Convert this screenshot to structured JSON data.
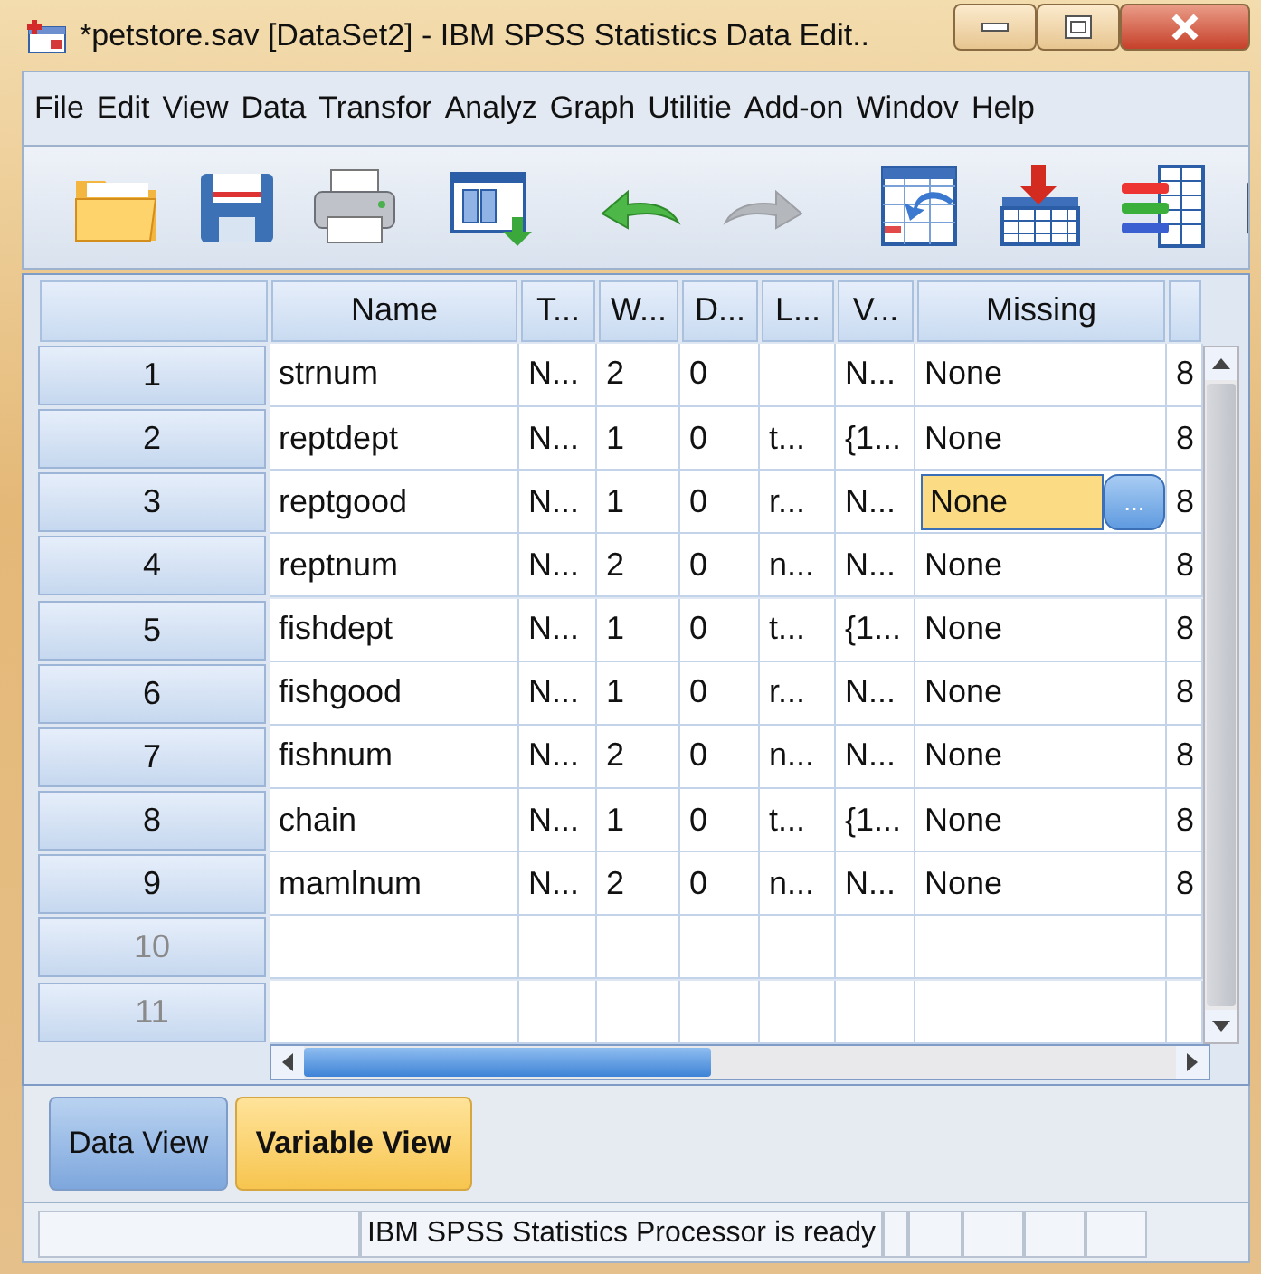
{
  "window": {
    "title": "*petstore.sav [DataSet2] - IBM SPSS Statistics Data Edit.."
  },
  "menu": [
    "File",
    "Edit",
    "View",
    "Data",
    "Transfor",
    "Analyz",
    "Graph",
    "Utilitie",
    "Add-on",
    "Windov",
    "Help"
  ],
  "toolbar": [
    {
      "kind": "open",
      "disabled": false
    },
    {
      "kind": "save",
      "disabled": false
    },
    {
      "kind": "print",
      "disabled": false
    },
    {
      "kind": "recall",
      "disabled": false
    },
    {
      "kind": "undo",
      "disabled": false
    },
    {
      "kind": "redo",
      "disabled": true
    },
    {
      "kind": "goto",
      "disabled": false
    },
    {
      "kind": "insert",
      "disabled": false
    },
    {
      "kind": "variables",
      "disabled": false
    },
    {
      "kind": "partial",
      "disabled": false
    }
  ],
  "table": {
    "columns": [
      {
        "label": "Name",
        "current": false
      },
      {
        "label": "T...",
        "current": false
      },
      {
        "label": "W...",
        "current": false
      },
      {
        "label": "D...",
        "current": false
      },
      {
        "label": "L...",
        "current": false
      },
      {
        "label": "V...",
        "current": false
      },
      {
        "label": "Missing",
        "current": true
      },
      {
        "current": false
      }
    ],
    "cell_button": "...",
    "rows": [
      {
        "number": "1",
        "defined": true,
        "selected": false,
        "cells": [
          "strnum",
          "N...",
          "2",
          "0",
          "",
          "N...",
          "None",
          "8"
        ]
      },
      {
        "number": "2",
        "defined": true,
        "selected": false,
        "cells": [
          "reptdept",
          "N...",
          "1",
          "0",
          "t...",
          "{1...",
          "None",
          "8"
        ]
      },
      {
        "number": "3",
        "defined": true,
        "selected": true,
        "cells": [
          "reptgood",
          "N...",
          "1",
          "0",
          "r...",
          "N...",
          "None",
          "8"
        ]
      },
      {
        "number": "4",
        "defined": true,
        "selected": false,
        "cells": [
          "reptnum",
          "N...",
          "2",
          "0",
          "n...",
          "N...",
          "None",
          "8"
        ]
      },
      {
        "number": "5",
        "defined": true,
        "selected": false,
        "cells": [
          "fishdept",
          "N...",
          "1",
          "0",
          "t...",
          "{1...",
          "None",
          "8"
        ]
      },
      {
        "number": "6",
        "defined": true,
        "selected": false,
        "cells": [
          "fishgood",
          "N...",
          "1",
          "0",
          "r...",
          "N...",
          "None",
          "8"
        ]
      },
      {
        "number": "7",
        "defined": true,
        "selected": false,
        "cells": [
          "fishnum",
          "N...",
          "2",
          "0",
          "n...",
          "N...",
          "None",
          "8"
        ]
      },
      {
        "number": "8",
        "defined": true,
        "selected": false,
        "cells": [
          "chain",
          "N...",
          "1",
          "0",
          "t...",
          "{1...",
          "None",
          "8"
        ]
      },
      {
        "number": "9",
        "defined": true,
        "selected": false,
        "cells": [
          "mamlnum",
          "N...",
          "2",
          "0",
          "n...",
          "N...",
          "None",
          "8"
        ]
      },
      {
        "number": "10",
        "defined": false,
        "selected": false
      },
      {
        "number": "11",
        "defined": false,
        "selected": false
      }
    ]
  },
  "tabs": [
    {
      "label": "Data View",
      "selected": false
    },
    {
      "label": "Variable View",
      "selected": true
    }
  ],
  "status_bar": {
    "message": "IBM SPSS Statistics Processor is ready"
  }
}
